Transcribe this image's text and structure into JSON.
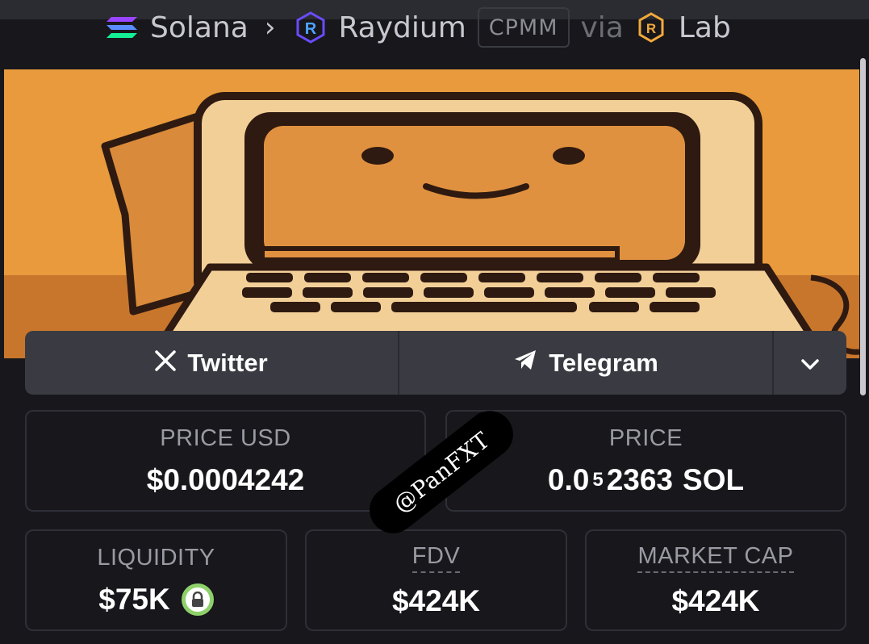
{
  "breadcrumb": {
    "chain": "Solana",
    "dex": "Raydium",
    "pool_type": "CPMM",
    "via": "via",
    "launchpad": "Lab"
  },
  "banner": {
    "image": "smiling retro computer mascot",
    "background": "#e89a3c"
  },
  "socials": {
    "twitter_label": "Twitter",
    "telegram_label": "Telegram",
    "more_icon": "chevron-down-icon"
  },
  "stats": {
    "price_usd": {
      "label": "PRICE USD",
      "value": "$0.0004242"
    },
    "price_native": {
      "label": "PRICE",
      "prefix": "0.0",
      "zeros": "5",
      "digits": "2363",
      "unit": "SOL"
    },
    "liquidity": {
      "label": "LIQUIDITY",
      "value": "$75K",
      "locked": true
    },
    "fdv": {
      "label": "FDV",
      "value": "$424K"
    },
    "market_cap": {
      "label": "MARKET CAP",
      "value": "$424K"
    }
  },
  "watermark": "@PanFXT",
  "colors": {
    "background": "#17171c",
    "card_border": "#2f3037",
    "lock_green": "#8ed16a"
  }
}
